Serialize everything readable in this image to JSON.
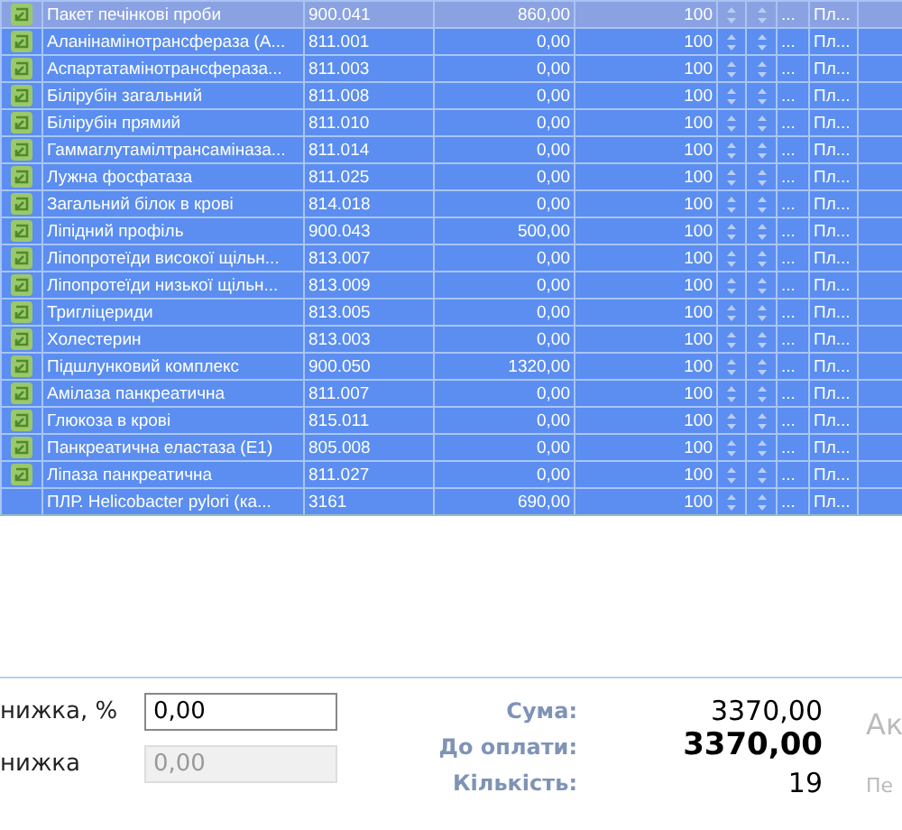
{
  "table": {
    "rows": [
      {
        "icon": true,
        "current": true,
        "name": "Пакет печінкові проби",
        "code": "900.041",
        "price": "860,00",
        "qty": "100",
        "more": "...",
        "payment": "Пл..."
      },
      {
        "icon": true,
        "current": false,
        "name": "Аланінамінотрансфераза (А...",
        "code": "811.001",
        "price": "0,00",
        "qty": "100",
        "more": "...",
        "payment": "Пл..."
      },
      {
        "icon": true,
        "current": false,
        "name": "Аспартатамінотрансфераза...",
        "code": "811.003",
        "price": "0,00",
        "qty": "100",
        "more": "...",
        "payment": "Пл..."
      },
      {
        "icon": true,
        "current": false,
        "name": "Білірубін загальний",
        "code": "811.008",
        "price": "0,00",
        "qty": "100",
        "more": "...",
        "payment": "Пл..."
      },
      {
        "icon": true,
        "current": false,
        "name": "Білірубін прямий",
        "code": "811.010",
        "price": "0,00",
        "qty": "100",
        "more": "...",
        "payment": "Пл..."
      },
      {
        "icon": true,
        "current": false,
        "name": "Гаммаглутамілтрансаміназа...",
        "code": "811.014",
        "price": "0,00",
        "qty": "100",
        "more": "...",
        "payment": "Пл..."
      },
      {
        "icon": true,
        "current": false,
        "name": "Лужна фосфатаза",
        "code": "811.025",
        "price": "0,00",
        "qty": "100",
        "more": "...",
        "payment": "Пл..."
      },
      {
        "icon": true,
        "current": false,
        "name": "Загальний білок в крові",
        "code": "814.018",
        "price": "0,00",
        "qty": "100",
        "more": "...",
        "payment": "Пл..."
      },
      {
        "icon": true,
        "current": false,
        "name": "Ліпідний профіль",
        "code": "900.043",
        "price": "500,00",
        "qty": "100",
        "more": "...",
        "payment": "Пл..."
      },
      {
        "icon": true,
        "current": false,
        "name": "Ліпопротеїди високої щільн...",
        "code": "813.007",
        "price": "0,00",
        "qty": "100",
        "more": "...",
        "payment": "Пл..."
      },
      {
        "icon": true,
        "current": false,
        "name": "Ліпопротеїди низької щільн...",
        "code": "813.009",
        "price": "0,00",
        "qty": "100",
        "more": "...",
        "payment": "Пл..."
      },
      {
        "icon": true,
        "current": false,
        "name": "Тригліцериди",
        "code": "813.005",
        "price": "0,00",
        "qty": "100",
        "more": "...",
        "payment": "Пл..."
      },
      {
        "icon": true,
        "current": false,
        "name": "Холестерин",
        "code": "813.003",
        "price": "0,00",
        "qty": "100",
        "more": "...",
        "payment": "Пл..."
      },
      {
        "icon": true,
        "current": false,
        "name": "Підшлунковий комплекс",
        "code": "900.050",
        "price": "1320,00",
        "qty": "100",
        "more": "...",
        "payment": "Пл..."
      },
      {
        "icon": true,
        "current": false,
        "name": "Амілаза панкреатична",
        "code": "811.007",
        "price": "0,00",
        "qty": "100",
        "more": "...",
        "payment": "Пл..."
      },
      {
        "icon": true,
        "current": false,
        "name": "Глюкоза в крові",
        "code": "815.011",
        "price": "0,00",
        "qty": "100",
        "more": "...",
        "payment": "Пл..."
      },
      {
        "icon": true,
        "current": false,
        "name": "Панкреатична еластаза (Е1)",
        "code": "805.008",
        "price": "0,00",
        "qty": "100",
        "more": "...",
        "payment": "Пл..."
      },
      {
        "icon": true,
        "current": false,
        "name": "Ліпаза панкреатична",
        "code": "811.027",
        "price": "0,00",
        "qty": "100",
        "more": "...",
        "payment": "Пл..."
      },
      {
        "icon": false,
        "current": false,
        "name": "ПЛР. Helicobacter pylori (ка...",
        "code": "3161",
        "price": "690,00",
        "qty": "100",
        "more": "...",
        "payment": "Пл..."
      }
    ]
  },
  "discount": [
    {
      "label": "нижка, %",
      "value": "0,00",
      "disabled": false
    },
    {
      "label": "нижка",
      "value": "0,00",
      "disabled": true
    }
  ],
  "totals": [
    {
      "label": "Сума:",
      "value": "3370,00",
      "bold": false
    },
    {
      "label": "До оплати:",
      "value": "3370,00",
      "bold": true
    },
    {
      "label": "Кількість:",
      "value": "19",
      "bold": false
    }
  ],
  "side_texts": [
    "Ак",
    "Пе"
  ]
}
